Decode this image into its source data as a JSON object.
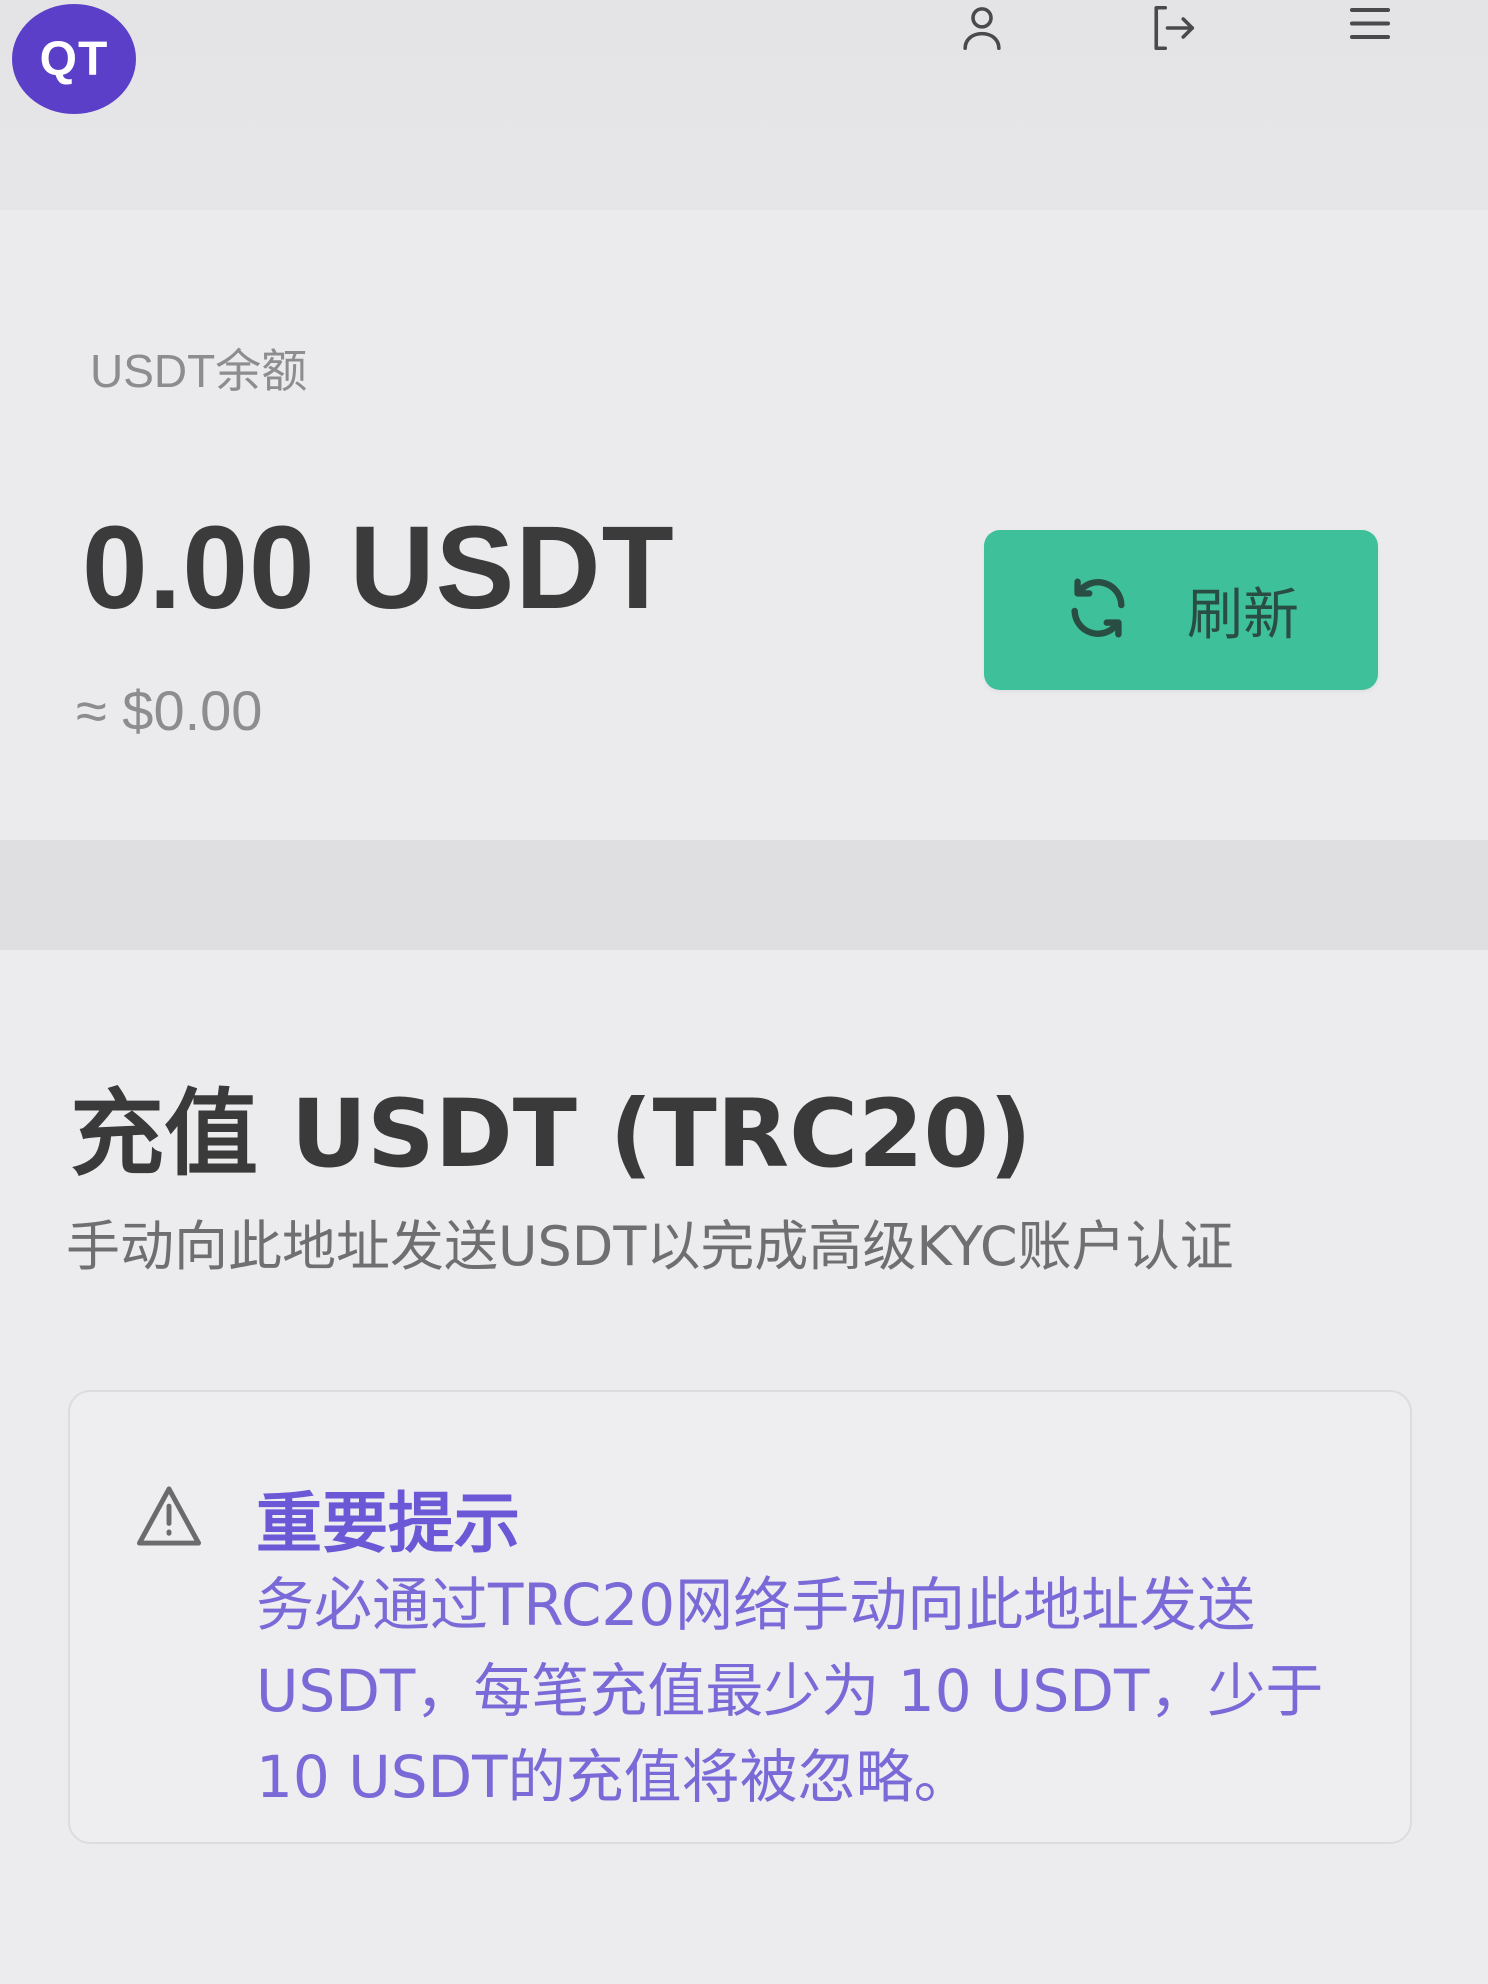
{
  "header": {
    "logo_text": "QT",
    "icons": [
      "user-icon",
      "logout-icon",
      "menu-icon"
    ]
  },
  "balance": {
    "label": "USDT余额",
    "amount": "0.00 USDT",
    "usd_equivalent": "≈ $0.00",
    "refresh_label": "刷新",
    "refresh_icon": "refresh-icon"
  },
  "deposit": {
    "title": "充值 USDT (TRC20)",
    "subtitle": "手动向此地址发送USDT以完成高级KYC账户认证",
    "notice": {
      "icon": "warning-icon",
      "title": "重要提示",
      "body": "务必通过TRC20网络手动向此地址发送USDT，每笔充值最少为 10 USDT，少于 10 USDT的充值将被忽略。"
    }
  },
  "colors": {
    "brand": "#5b3fc8",
    "refresh_button": "#3ec09a",
    "notice_text": "#7a6ad8",
    "background": "#ececee"
  }
}
